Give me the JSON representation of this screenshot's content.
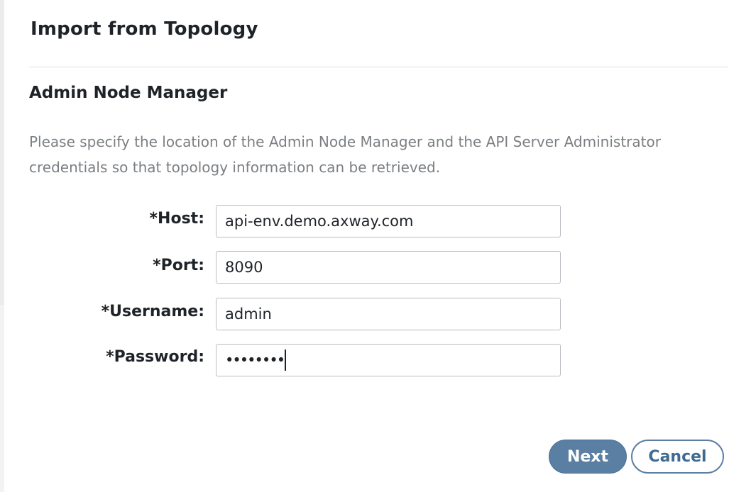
{
  "dialog": {
    "title": "Import from Topology",
    "section_title": "Admin Node Manager",
    "description": "Please specify the location of the Admin Node Manager and the API Server Administrator credentials so that topology information can be retrieved."
  },
  "form": {
    "host": {
      "label": "*Host:",
      "value": "api-env.demo.axway.com"
    },
    "port": {
      "label": "*Port:",
      "value": "8090"
    },
    "username": {
      "label": "*Username:",
      "value": "admin"
    },
    "password": {
      "label": "*Password:",
      "value": "••••••••"
    }
  },
  "buttons": {
    "next": "Next",
    "cancel": "Cancel"
  },
  "colors": {
    "primary_button": "#5a7fa3",
    "cancel_text": "#3f6b93",
    "description_text": "#7b7f83"
  }
}
